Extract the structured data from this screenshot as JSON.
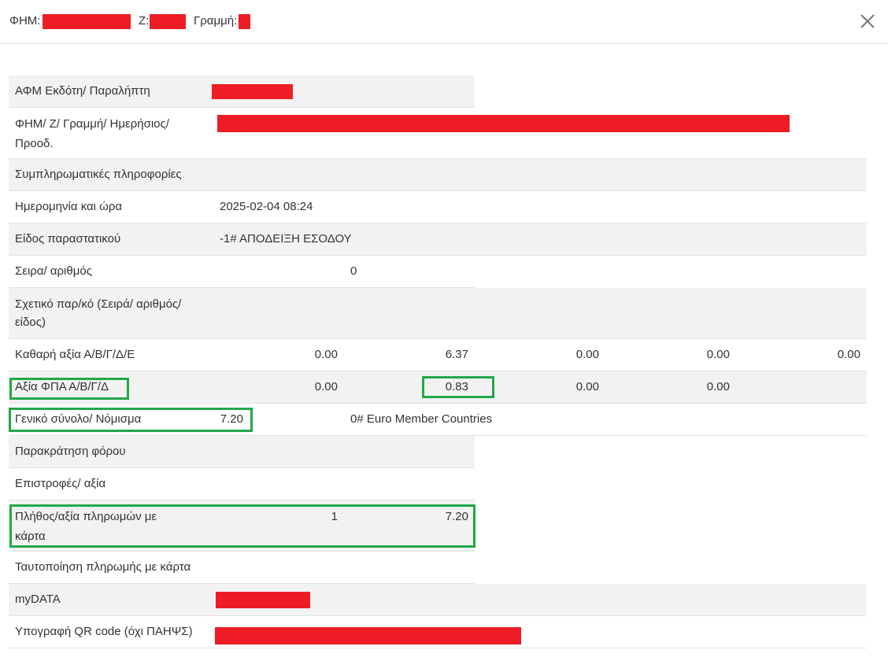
{
  "header": {
    "fhm_label": "ΦΗΜ:",
    "z_label": "Z:",
    "line_label": "Γραμμή:"
  },
  "icons": {
    "close": "close-icon"
  },
  "colors": {
    "redaction": "#ee1c25",
    "highlight": "#22a84a",
    "shade": "#f2f2f2"
  },
  "rows": {
    "afm": {
      "label": "ΑΦΜ Εκδότη/ Παραλήπτη"
    },
    "fhm": {
      "label_line1": "ΦΗΜ/ Ζ/ Γραμμή/ Ημερήσιος/",
      "label_line2": "Προοδ."
    },
    "extra": {
      "label": "Συμπληρωματικές πληροφορίες"
    },
    "datetime": {
      "label": "Ημερομηνία και ώρα",
      "value": "2025-02-04 08:24"
    },
    "doctype": {
      "label": "Είδος παραστατικού",
      "value": "-1# ΑΠΟΔΕΙΞΗ ΕΣΟΔΟΥ"
    },
    "series": {
      "label": "Σειρα/ αριθμός",
      "value": "0"
    },
    "related": {
      "label_line1": "Σχετικό παρ/κό (Σειρά/ αριθμός/",
      "label_line2": "είδος)"
    },
    "net": {
      "label": "Καθαρή αξία Α/Β/Γ/Δ/Ε",
      "values": [
        "0.00",
        "6.37",
        "0.00",
        "0.00",
        "0.00"
      ]
    },
    "vat": {
      "label": "Αξία ΦΠΑ Α/Β/Γ/Δ",
      "values": [
        "0.00",
        "0.83",
        "0.00",
        "0.00"
      ]
    },
    "total": {
      "label": "Γενικό σύνολο/ Νόμισμα",
      "amount": "7.20",
      "currency": "0# Euro Member Countries"
    },
    "withholding": {
      "label": "Παρακράτηση φόρου"
    },
    "returns": {
      "label": "Επιστροφές/ αξία"
    },
    "card_payments": {
      "label_line1": "Πλήθος/αξία πληρωμών με",
      "label_line2": "κάρτα",
      "count": "1",
      "amount": "7.20"
    },
    "card_id": {
      "label": "Ταυτοποίηση πληρωμής με κάρτα"
    },
    "mydata": {
      "label": "myDATA"
    },
    "qr": {
      "label": "Υπογραφή QR code (όχι ΠΑΗΨΣ)"
    }
  }
}
